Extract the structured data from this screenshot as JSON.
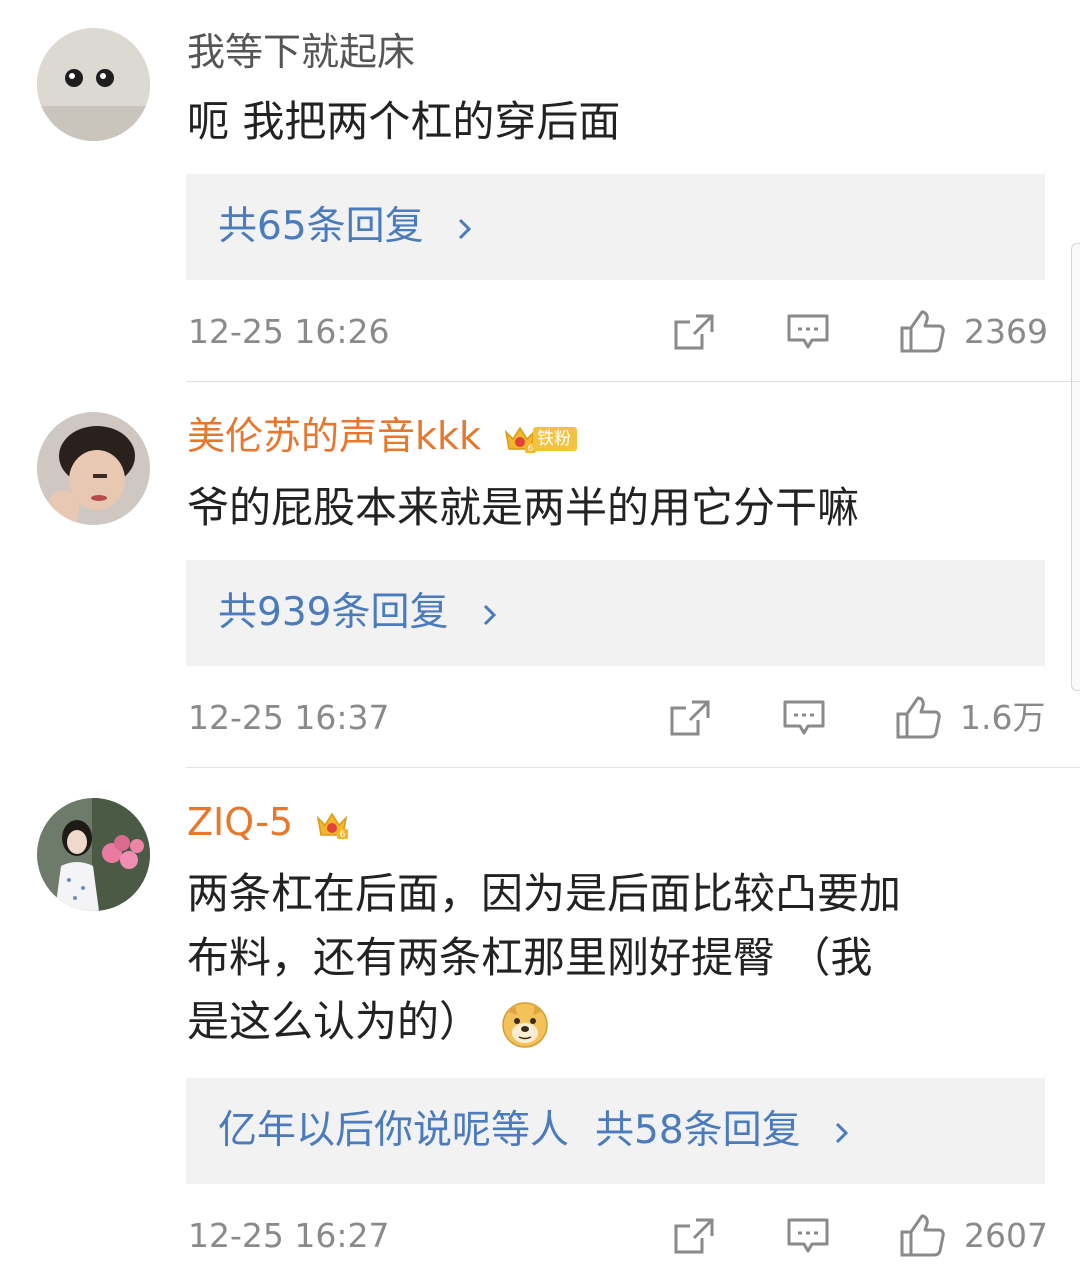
{
  "comments": [
    {
      "username": "我等下就起床",
      "text": "呃 我把两个杠的穿后面",
      "reply_names": "",
      "reply_label": "共65条回复",
      "time": "12-25 16:26",
      "likes": "2369"
    },
    {
      "username": "美伦苏的声音kkk",
      "fan_badge": "铁粉",
      "text": "爷的屁股本来就是两半的用它分干嘛",
      "reply_names": "",
      "reply_label": "共939条回复",
      "time": "12-25 16:37",
      "likes": "1.6万"
    },
    {
      "username": "ZIQ-5",
      "text_lines": [
        "两条杠在后面，因为是后面比较凸要加",
        "布料，还有两条杠那里刚好提臀 （我",
        "是这么认为的）"
      ],
      "reply_names": "亿年以后你说呢等人",
      "reply_label": "共58条回复",
      "time": "12-25 16:27",
      "likes": "2607"
    }
  ],
  "icons": {
    "share": "share-icon",
    "comment": "comment-icon",
    "like": "thumbs-up-icon",
    "chevron": "chevron-right-icon",
    "vip": "crown-vip-icon",
    "emoji": "doge-emoji-icon"
  },
  "colors": {
    "vip_name": "#e8772e",
    "link": "#4a7bbd",
    "meta": "#8a8a8a",
    "reply_bg": "#f2f2f2"
  }
}
